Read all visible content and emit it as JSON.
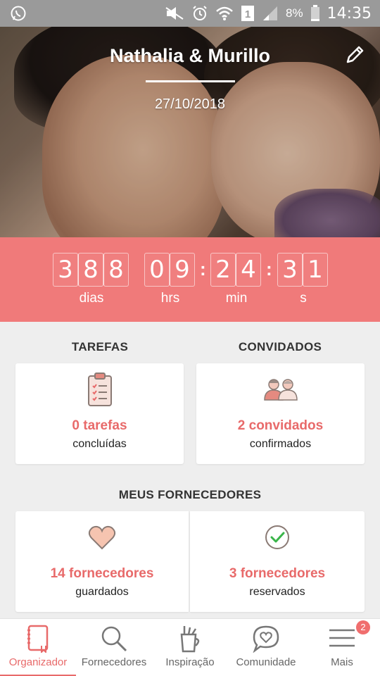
{
  "status_bar": {
    "icons": [
      "whatsapp-icon",
      "mute-icon",
      "alarm-icon",
      "wifi-icon",
      "sim-icon",
      "signal-icon",
      "battery-icon"
    ],
    "battery": "8%",
    "time": "14:35"
  },
  "hero": {
    "couple": "Nathalia & Murillo",
    "date": "27/10/2018"
  },
  "countdown": {
    "days": [
      "3",
      "8",
      "8"
    ],
    "hours": [
      "0",
      "9"
    ],
    "minutes": [
      "2",
      "4"
    ],
    "seconds": [
      "3",
      "1"
    ],
    "labels": {
      "days": "dias",
      "hours": "hrs",
      "minutes": "min",
      "seconds": "s"
    }
  },
  "tasks": {
    "title": "TAREFAS",
    "count": "0 tarefas",
    "sub": "concluídas"
  },
  "guests": {
    "title": "CONVIDADOS",
    "count": "2 convidados",
    "sub": "confirmados"
  },
  "vendors": {
    "title": "MEUS FORNECEDORES",
    "saved": {
      "count": "14 fornecedores",
      "sub": "guardados"
    },
    "booked": {
      "count": "3 fornecedores",
      "sub": "reservados"
    }
  },
  "nav": {
    "items": [
      {
        "label": "Organizador",
        "icon": "planner-icon"
      },
      {
        "label": "Fornecedores",
        "icon": "search-icon"
      },
      {
        "label": "Inspiração",
        "icon": "inspiration-icon"
      },
      {
        "label": "Comunidade",
        "icon": "community-icon"
      },
      {
        "label": "Mais",
        "icon": "menu-icon"
      }
    ],
    "badge": "2"
  },
  "colors": {
    "accent": "#f07a7a",
    "accent_text": "#e86a6a",
    "background": "#eeeeee"
  }
}
